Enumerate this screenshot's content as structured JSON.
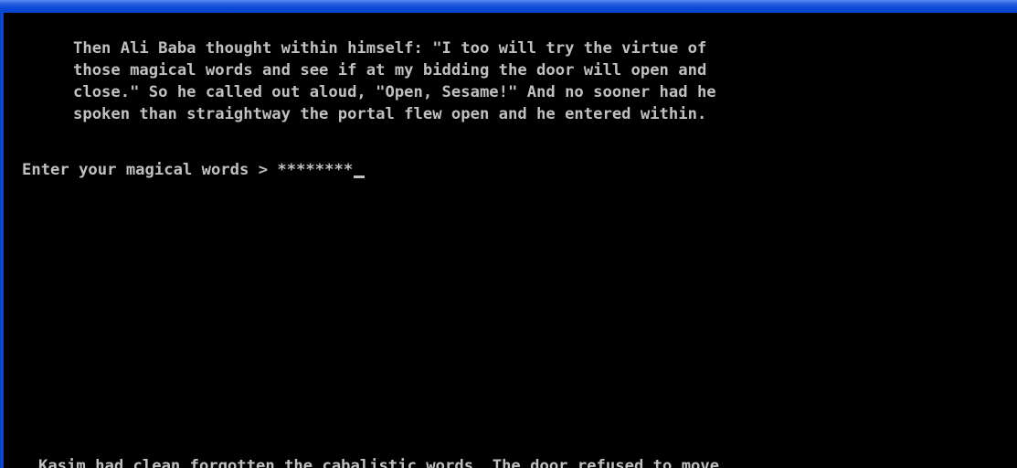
{
  "story": {
    "lines": [
      "Then Ali Baba thought within himself: \"I too will try the virtue of",
      "those magical words and see if at my bidding the door will open and",
      "close.\" So he called out aloud, \"Open, Sesame!\" And no sooner had he",
      "spoken than straightway the portal flew open and he entered within."
    ]
  },
  "prompt": {
    "label": "Enter your magical words > ",
    "input_value": "********"
  },
  "status_message": "...Kasim had clean forgotten the cabalistic words. The door refused to move.",
  "colors": {
    "background": "#000000",
    "text": "#c0c0c0",
    "window_frame": "#0a48d8"
  }
}
